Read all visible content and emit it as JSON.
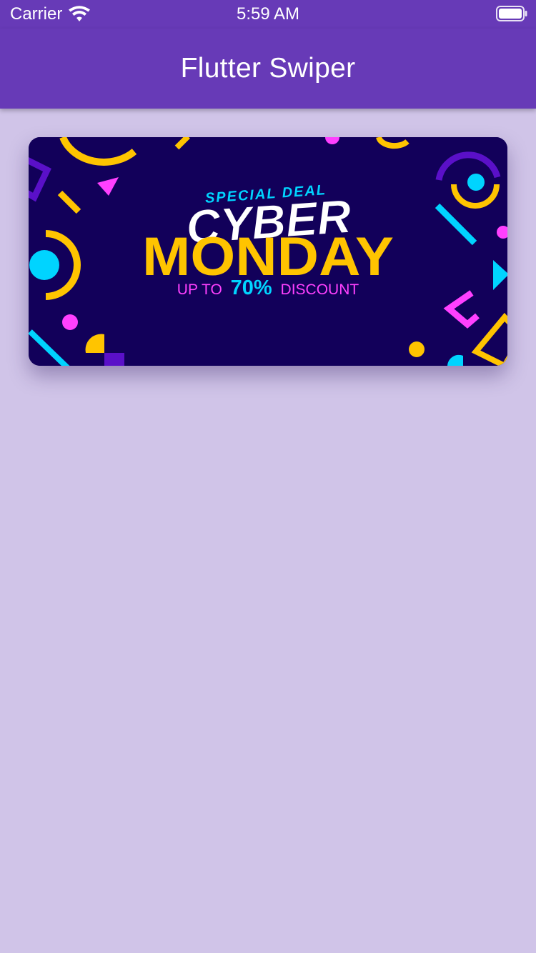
{
  "status_bar": {
    "carrier": "Carrier",
    "time": "5:59 AM",
    "wifi_icon": "wifi-icon",
    "battery_icon": "battery-icon"
  },
  "app_bar": {
    "title": "Flutter Swiper",
    "color": "#673ab7"
  },
  "swiper": {
    "slide": {
      "line1": "SPECIAL DEAL",
      "line2": "CYBER",
      "line3": "MONDAY",
      "line4_prefix": "UP TO",
      "line4_highlight": "70%",
      "line4_suffix": "DISCOUNT"
    }
  },
  "colors": {
    "background": "#d0c4e8",
    "banner_bg": "#12005a",
    "yellow": "#ffc400",
    "cyan": "#00d4ff",
    "magenta": "#ff40ff",
    "purple": "#5a10c8"
  }
}
